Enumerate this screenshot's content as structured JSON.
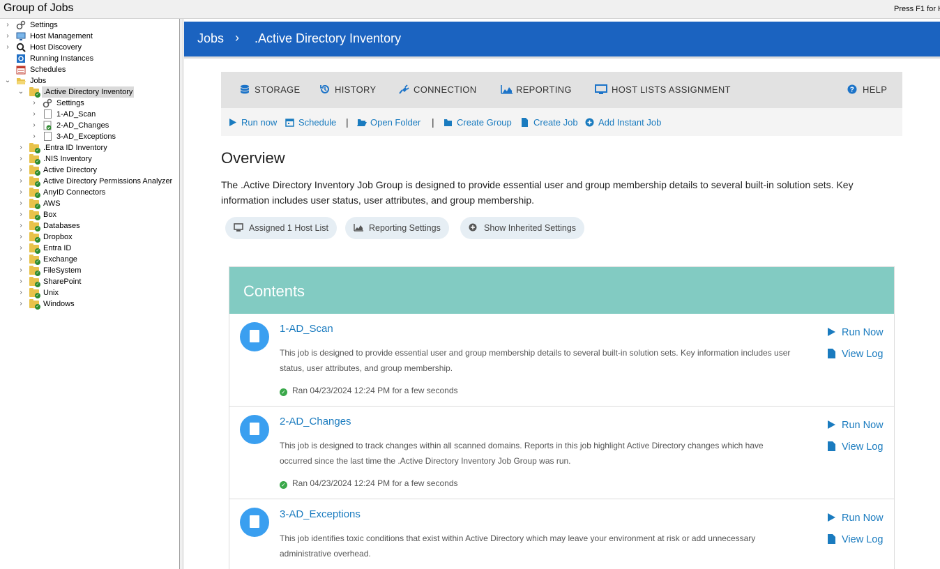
{
  "window": {
    "title": "Group of Jobs",
    "help_hint": "Press F1 for H"
  },
  "tree": {
    "top_items": [
      {
        "label": "Settings",
        "icon": "gear-icon"
      },
      {
        "label": "Host Management",
        "icon": "monitor-icon"
      },
      {
        "label": "Host Discovery",
        "icon": "magnifier-icon"
      },
      {
        "label": "Running Instances",
        "icon": "refresh-icon"
      },
      {
        "label": "Schedules",
        "icon": "calendar-icon"
      },
      {
        "label": "Jobs",
        "icon": "folder-open-icon"
      }
    ],
    "selected_group": ".Active Directory Inventory",
    "children": [
      {
        "label": "Settings",
        "icon": "gear-icon"
      },
      {
        "label": "1-AD_Scan",
        "icon": "job-file-icon"
      },
      {
        "label": "2-AD_Changes",
        "icon": "job-file-check-icon"
      },
      {
        "label": "3-AD_Exceptions",
        "icon": "job-file-icon"
      }
    ],
    "groups": [
      ".Entra ID Inventory",
      ".NIS Inventory",
      "Active Directory",
      "Active Directory Permissions Analyzer",
      "AnyID Connectors",
      "AWS",
      "Box",
      "Databases",
      "Dropbox",
      "Entra ID",
      "Exchange",
      "FileSystem",
      "SharePoint",
      "Unix",
      "Windows"
    ]
  },
  "header": {
    "crumb_root": "Jobs",
    "separator": "›",
    "crumb_current": ".Active Directory Inventory"
  },
  "tabs": {
    "storage": "STORAGE",
    "history": "HISTORY",
    "connection": "CONNECTION",
    "reporting": "REPORTING",
    "host_lists": "HOST LISTS ASSIGNMENT",
    "help": "HELP"
  },
  "actions": {
    "run_now": "Run now",
    "schedule": "Schedule",
    "open_folder": "Open Folder",
    "create_group": "Create Group",
    "create_job": "Create Job",
    "add_instant_job": "Add Instant Job",
    "pipe": "|"
  },
  "overview": {
    "title": "Overview",
    "description": "The .Active Directory Inventory Job Group is designed to provide essential user and group membership details to several built-in solution sets. Key information includes user status, user attributes, and group membership.",
    "pills": {
      "assigned": "Assigned 1 Host List",
      "reporting": "Reporting Settings",
      "inherited": "Show Inherited Settings"
    }
  },
  "contents": {
    "title": "Contents",
    "run_label": "Run Now",
    "log_label": "View Log",
    "jobs": [
      {
        "name": "1-AD_Scan",
        "description": "This job is designed to provide essential user and group membership details to several built-in solution sets. Key information includes user status, user attributes, and group membership.",
        "status": "Ran 04/23/2024 12:24 PM for a few seconds"
      },
      {
        "name": "2-AD_Changes",
        "description": "This job is designed to track changes within all scanned domains. Reports in this job highlight Active Directory changes which have occurred since the last time the .Active Directory Inventory Job Group was run.",
        "status": "Ran 04/23/2024 12:24 PM for a few seconds"
      },
      {
        "name": "3-AD_Exceptions",
        "description": "This job identifies toxic conditions that exist within Active Directory which may leave your environment at risk or add unnecessary administrative overhead.",
        "status": ""
      }
    ]
  },
  "colors": {
    "header": "#1b63c0",
    "contents_header": "#82cbc2",
    "link": "#1a7bbf",
    "job_icon": "#3a9ff0",
    "ok": "#3aa84a"
  }
}
